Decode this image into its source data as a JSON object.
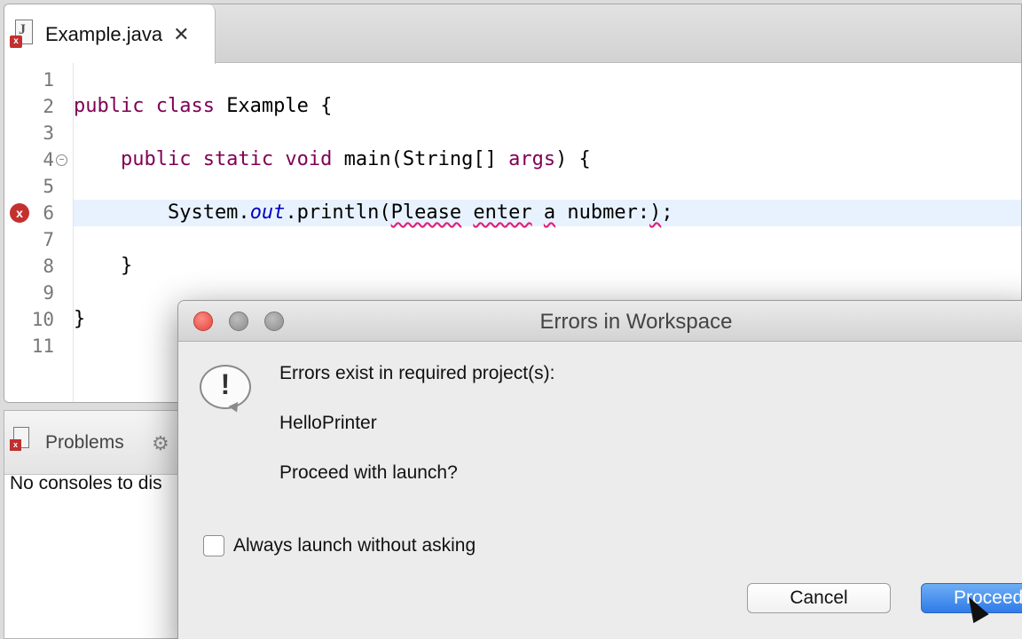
{
  "editor": {
    "tab_title": "Example.java",
    "tab_close": "✕",
    "lines": [
      {
        "num": "1",
        "segments": []
      },
      {
        "num": "2",
        "segments": [
          {
            "t": "public class ",
            "c": "kw"
          },
          {
            "t": "Example {",
            "c": ""
          }
        ]
      },
      {
        "num": "3",
        "segments": []
      },
      {
        "num": "4",
        "segments": [
          {
            "t": "    public static void ",
            "c": "kw"
          },
          {
            "t": "main(String[] ",
            "c": ""
          },
          {
            "t": "args",
            "c": "kw"
          },
          {
            "t": ") {",
            "c": ""
          }
        ]
      },
      {
        "num": "5",
        "segments": []
      },
      {
        "num": "6",
        "segments": [
          {
            "t": "        System.",
            "c": ""
          },
          {
            "t": "out",
            "c": "it"
          },
          {
            "t": ".println(",
            "c": ""
          },
          {
            "t": "Please",
            "c": "err"
          },
          {
            "t": " ",
            "c": ""
          },
          {
            "t": "enter",
            "c": "err"
          },
          {
            "t": " ",
            "c": ""
          },
          {
            "t": "a",
            "c": "err"
          },
          {
            "t": " nubmer:",
            "c": ""
          },
          {
            "t": ")",
            "c": "err"
          },
          {
            "t": ";",
            "c": ""
          }
        ]
      },
      {
        "num": "7",
        "segments": []
      },
      {
        "num": "8",
        "segments": [
          {
            "t": "    }",
            "c": ""
          }
        ]
      },
      {
        "num": "9",
        "segments": []
      },
      {
        "num": "10",
        "segments": [
          {
            "t": "}",
            "c": ""
          }
        ]
      },
      {
        "num": "11",
        "segments": []
      }
    ],
    "highlighted_line": 6,
    "error_line": 6,
    "fold_line": 4
  },
  "panel": {
    "problems_label": "Problems",
    "console_text": "No consoles to dis"
  },
  "dialog": {
    "title": "Errors in Workspace",
    "message": "Errors exist in required project(s):",
    "project": "HelloPrinter",
    "question": "Proceed with launch?",
    "checkbox_label": "Always launch without asking",
    "checkbox_checked": false,
    "cancel_label": "Cancel",
    "proceed_label": "Proceed"
  },
  "icons": {
    "file": "java-file-error-icon",
    "close": "close-icon",
    "error": "error-marker-icon",
    "fold": "fold-collapse-icon",
    "problems": "problems-icon",
    "console": "console-icon",
    "alert": "alert-icon"
  }
}
